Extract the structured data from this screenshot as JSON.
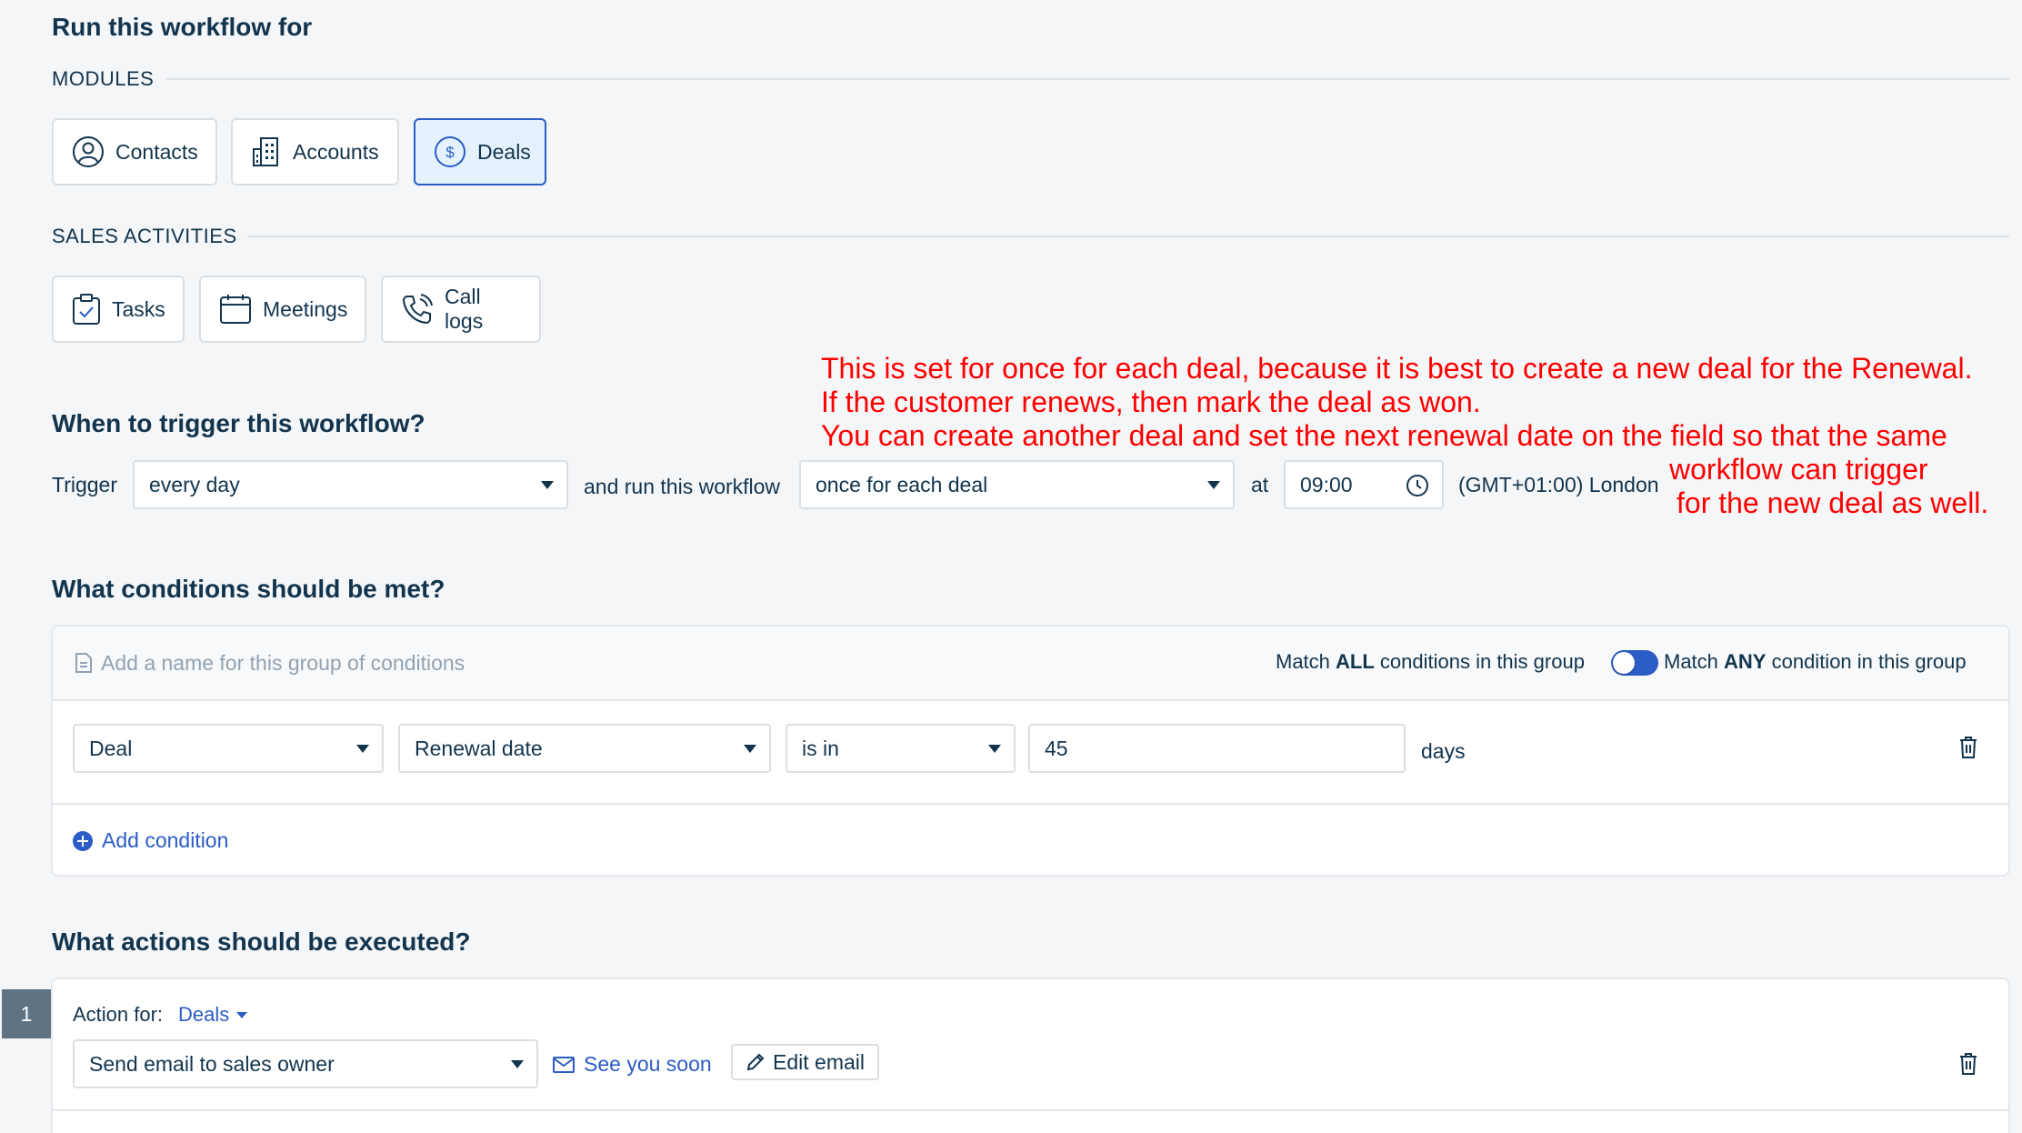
{
  "header": {
    "title": "Run this workflow for"
  },
  "modules": {
    "label": "MODULES",
    "items": [
      {
        "label": "Contacts",
        "icon": "contact-icon"
      },
      {
        "label": "Accounts",
        "icon": "building-icon"
      },
      {
        "label": "Deals",
        "icon": "dollar-icon",
        "selected": true
      }
    ]
  },
  "sales_activities": {
    "label": "SALES ACTIVITIES",
    "items": [
      {
        "label": "Tasks",
        "icon": "task-icon"
      },
      {
        "label": "Meetings",
        "icon": "calendar-icon"
      },
      {
        "label": "Call logs",
        "icon": "phone-icon"
      }
    ]
  },
  "annotation": {
    "line1": "This is set for once for each deal, because it is best to create a new deal for the Renewal.",
    "line2": "If the customer renews, then mark the deal as won.",
    "line3": "You can create another deal and set the next renewal date on the field so that the same",
    "line4": "workflow can trigger",
    "line5": "for the new deal as well."
  },
  "trigger": {
    "title": "When to trigger this workflow?",
    "trigger_label": "Trigger",
    "trigger_value": "every day",
    "run_label": "and run this workflow",
    "run_value": "once for each deal",
    "at_label": "at",
    "time_value": "09:00",
    "timezone": "(GMT+01:00) London"
  },
  "conditions": {
    "title": "What conditions should be met?",
    "group_name_placeholder": "Add a name for this group of conditions",
    "match_all_prefix": "Match ",
    "match_all_bold": "ALL",
    "match_all_suffix": " conditions in this group",
    "match_any_prefix": "Match ",
    "match_any_bold": "ANY",
    "match_any_suffix": " condition in this group",
    "row": {
      "entity": "Deal",
      "field": "Renewal date",
      "operator": "is in",
      "value": "45",
      "unit": "days"
    },
    "add_condition": "Add condition"
  },
  "actions": {
    "title": "What actions should be executed?",
    "step_number": "1",
    "action_for_label": "Action for:",
    "action_for_value": "Deals",
    "action_value": "Send email to sales owner",
    "email_name": "See you soon",
    "edit_email": "Edit email"
  },
  "colors": {
    "accent": "#2c5cc5",
    "annotation": "#ff0000",
    "text": "#12344d",
    "selected_bg": "#e5f2fd"
  }
}
